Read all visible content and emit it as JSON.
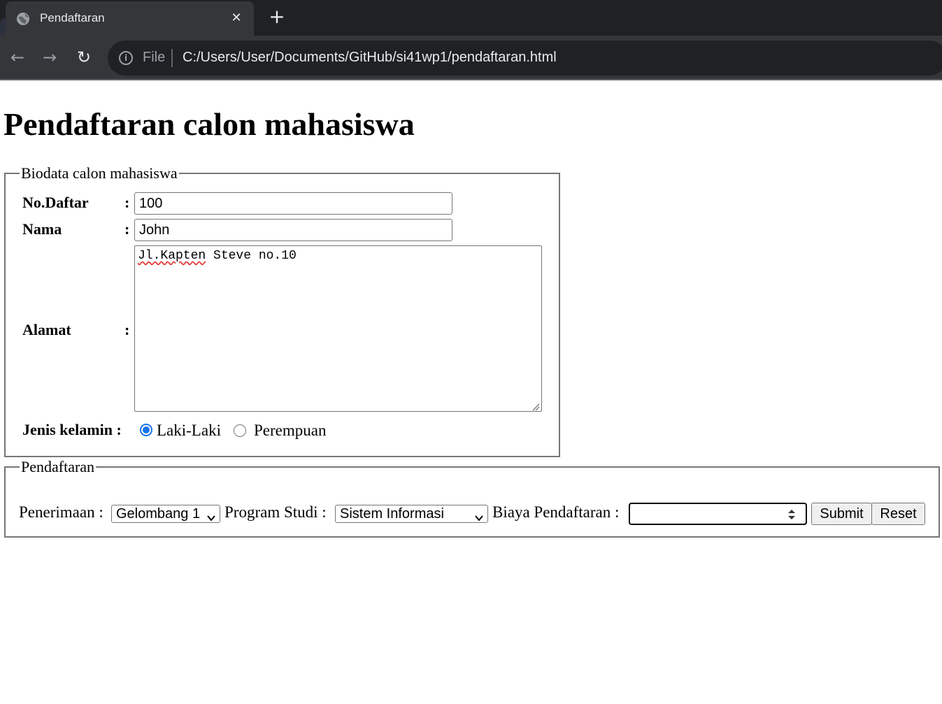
{
  "browser": {
    "tab_title": "Pendaftaran",
    "close_glyph": "✕",
    "new_tab_glyph": "+",
    "back_glyph": "←",
    "forward_glyph": "→",
    "reload_glyph": "↻",
    "info_glyph": "i",
    "scheme_label": "File",
    "url": "C:/Users/User/Documents/GitHub/si41wp1/pendaftaran.html"
  },
  "page": {
    "heading": "Pendaftaran calon mahasiswa"
  },
  "biodata": {
    "legend": "Biodata calon mahasiswa",
    "colon": ":",
    "no_daftar_label": "No.Daftar",
    "no_daftar_value": "100",
    "nama_label": "Nama",
    "nama_value": "John",
    "alamat_label": "Alamat",
    "alamat_value_misspelled": "Jl.Kapten",
    "alamat_value_rest": " Steve no.10",
    "gender_label": "Jenis kelamin :",
    "gender_options": [
      "Laki-Laki",
      "Perempuan"
    ],
    "gender_selected": "Laki-Laki"
  },
  "registration": {
    "legend": "Pendaftaran",
    "penerimaan_label": "Penerimaan :",
    "penerimaan_value": "Gelombang 1",
    "prodi_label": "Program Studi :",
    "prodi_value": "Sistem Informasi",
    "biaya_label": "Biaya Pendaftaran :",
    "biaya_value": "",
    "submit_label": "Submit",
    "reset_label": "Reset"
  },
  "colors": {
    "tabstrip_bg": "#202124",
    "toolbar_bg": "#35363a",
    "radio_accent": "#1a73e8",
    "border": "#767676"
  }
}
